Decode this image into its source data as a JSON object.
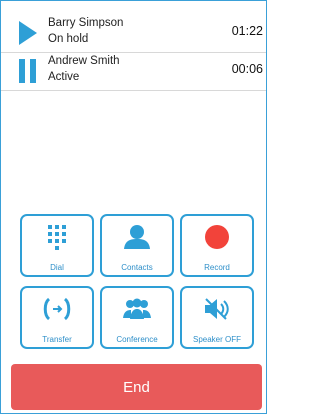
{
  "calls": [
    {
      "name": "Barry Simpson",
      "status": "On hold",
      "duration": "01:22",
      "icon": "play-icon"
    },
    {
      "name": "Andrew Smith",
      "status": "Active",
      "duration": "00:06",
      "icon": "pause-icon"
    }
  ],
  "actions": [
    {
      "label": "Dial",
      "icon": "dialpad-icon"
    },
    {
      "label": "Contacts",
      "icon": "contact-icon"
    },
    {
      "label": "Record",
      "icon": "record-icon"
    },
    {
      "label": "Transfer",
      "icon": "transfer-icon"
    },
    {
      "label": "Conference",
      "icon": "conference-icon"
    },
    {
      "label": "Speaker OFF",
      "icon": "speaker-icon"
    }
  ],
  "end_label": "End",
  "colors": {
    "accent": "#2e9fd6",
    "end": "#e85a5a",
    "record": "#f2433a"
  }
}
